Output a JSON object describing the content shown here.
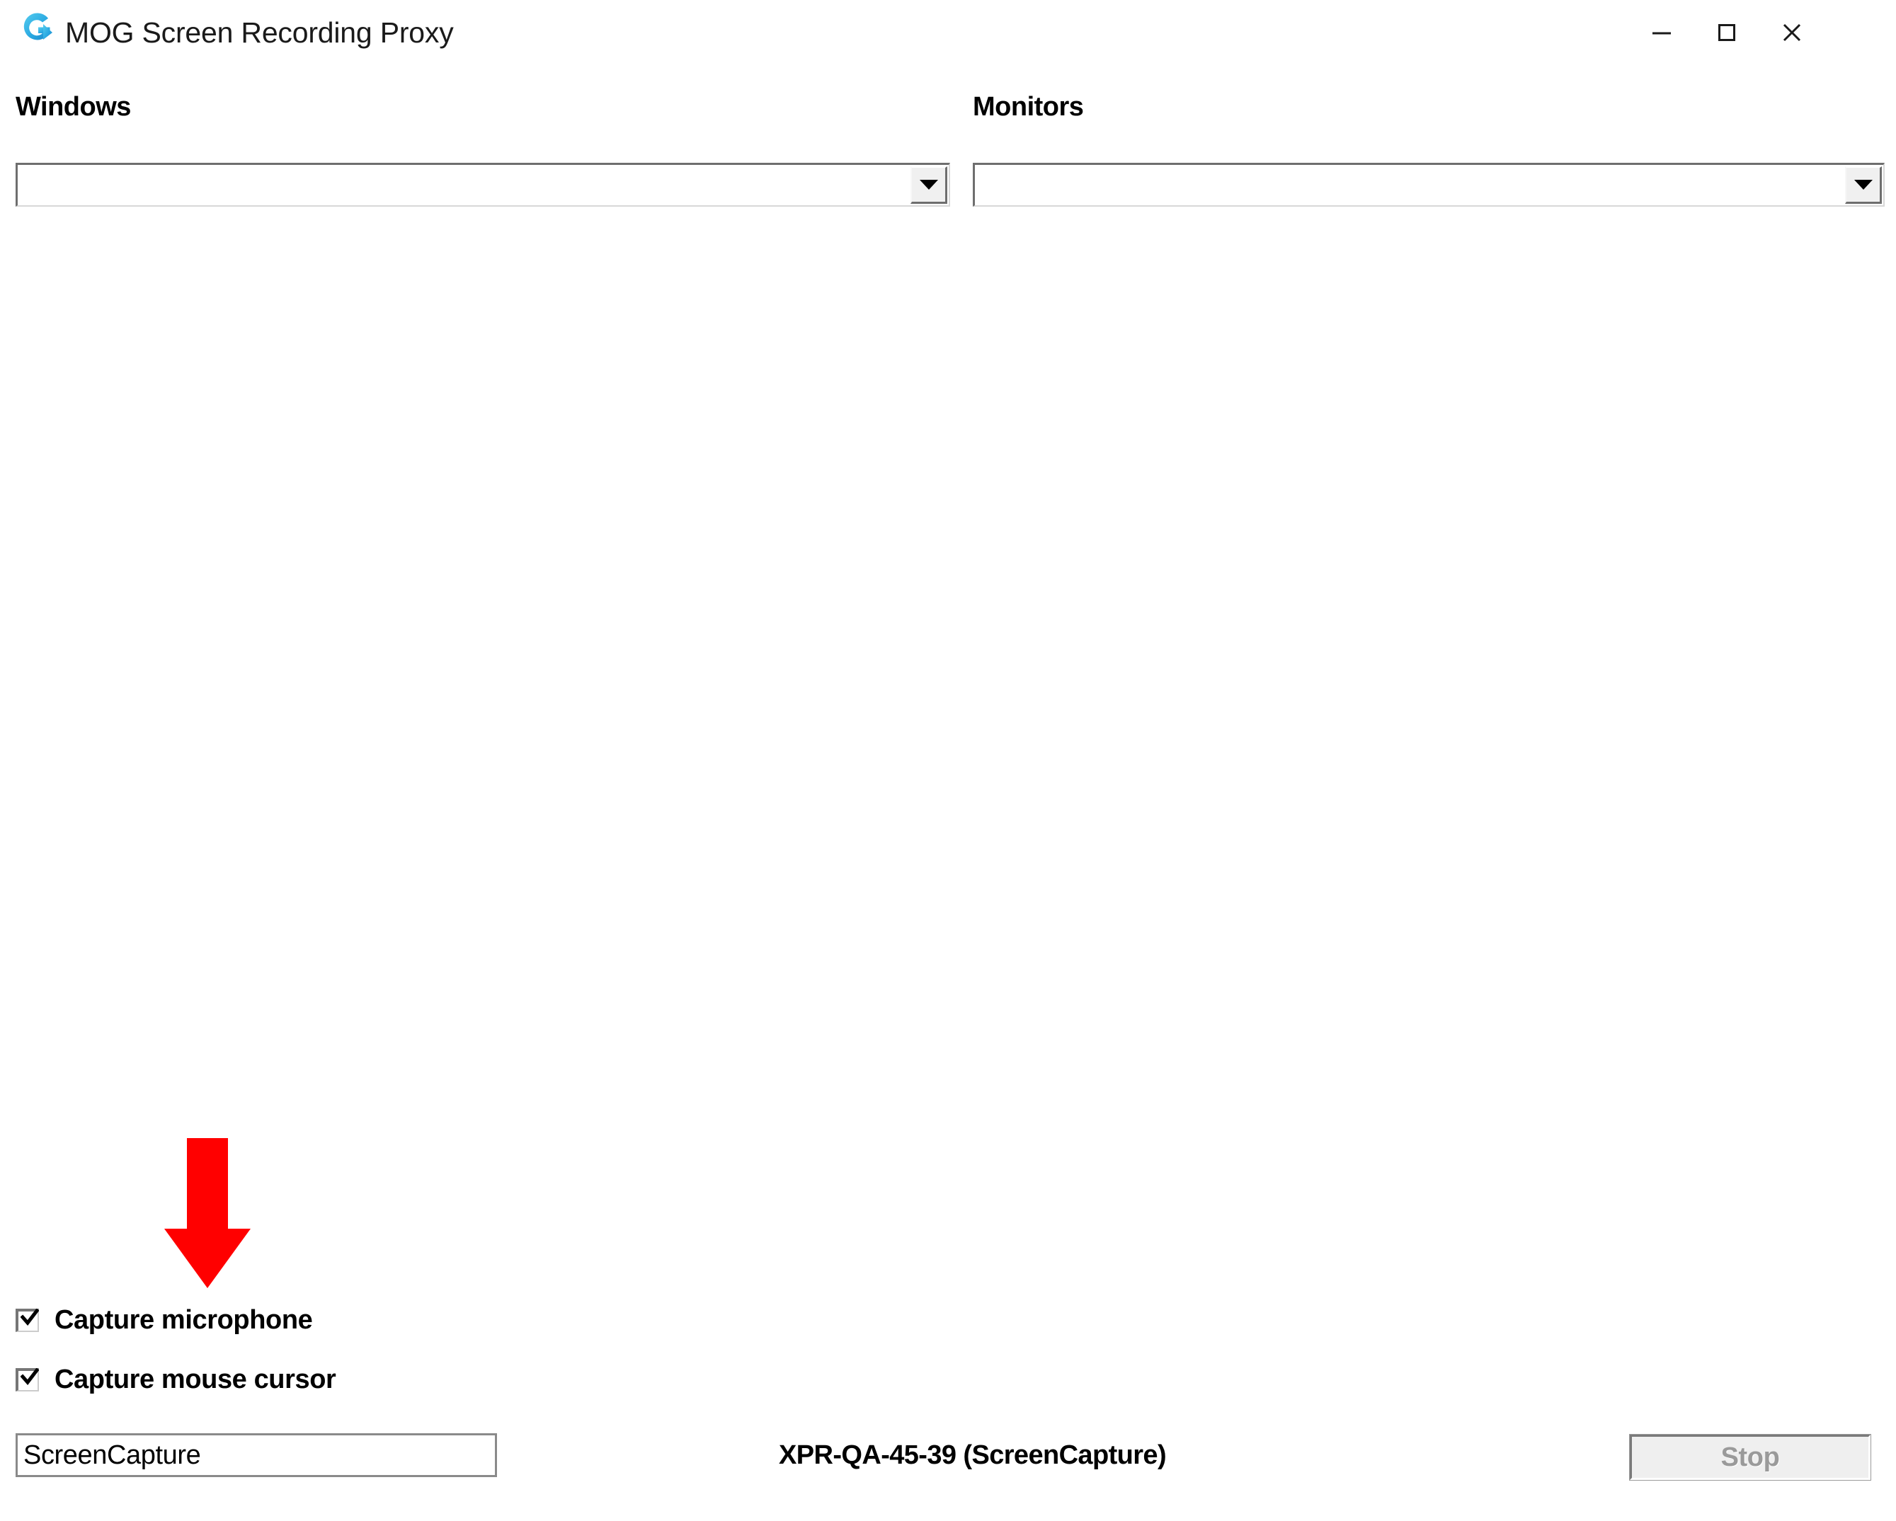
{
  "window": {
    "title": "MOG Screen Recording Proxy",
    "logo_icon": "mog-circular-arrow-logo",
    "logo_color": "#29A8E0",
    "background": "#ffffff",
    "controls": {
      "minimize_label": "Minimize",
      "maximize_label": "Maximize",
      "close_label": "Close",
      "minimize_icon": "minimize-icon",
      "maximize_icon": "maximize-icon",
      "close_icon": "close-icon"
    }
  },
  "sources": {
    "windows": {
      "label": "Windows",
      "selected": "",
      "dropdown_icon": "chevron-down-icon"
    },
    "monitors": {
      "label": "Monitors",
      "selected": "",
      "dropdown_icon": "chevron-down-icon"
    }
  },
  "annotation": {
    "arrow_icon": "down-arrow-annotation",
    "color": "#FF0000",
    "points_at": "Capture microphone"
  },
  "options": [
    {
      "id": "capture-microphone",
      "label": "Capture microphone",
      "checked": true,
      "check_icon": "check-icon"
    },
    {
      "id": "capture-mouse-cursor",
      "label": "Capture mouse cursor",
      "checked": true,
      "check_icon": "check-icon"
    }
  ],
  "footer": {
    "recording_name": {
      "value": "ScreenCapture",
      "placeholder": ""
    },
    "status": "XPR-QA-45-39 (ScreenCapture)",
    "stop_button": {
      "label": "Stop",
      "disabled": true
    }
  }
}
